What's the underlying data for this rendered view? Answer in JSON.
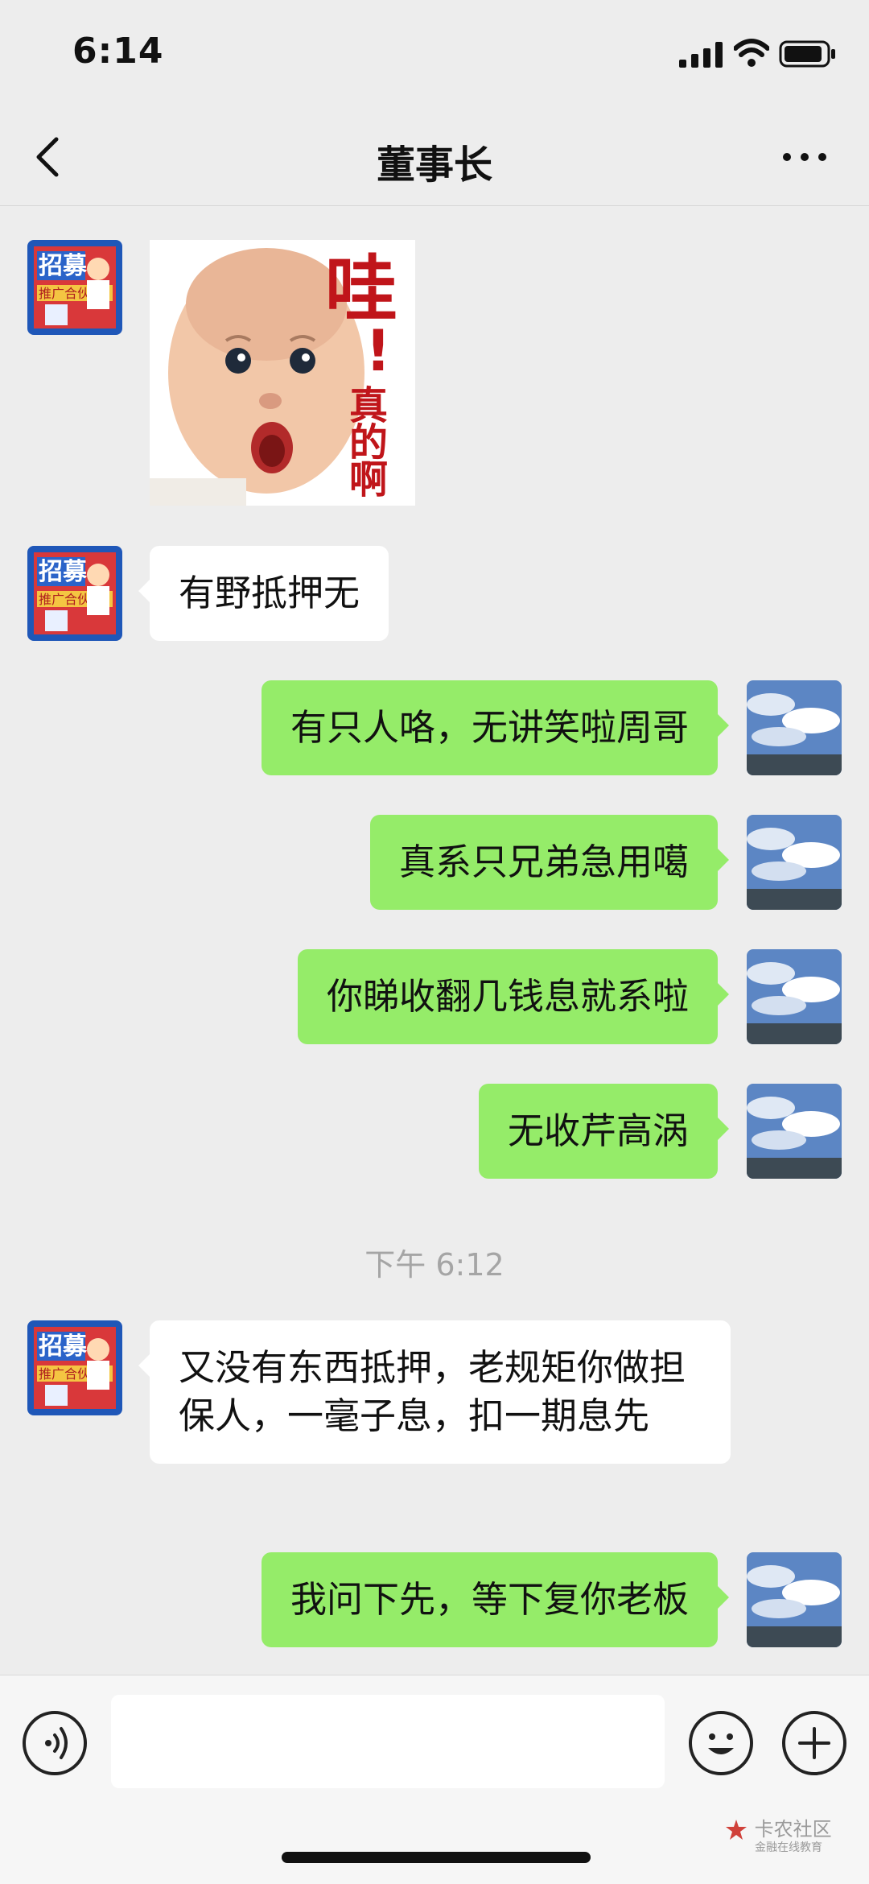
{
  "status_bar": {
    "time": "6:14"
  },
  "header": {
    "title": "董事长"
  },
  "sticker": {
    "big_char": "哇",
    "exclaim": "!",
    "lines": [
      "真",
      "的",
      "啊"
    ]
  },
  "avatar_contact": {
    "line1": "招募",
    "line2": "推广合伙人"
  },
  "messages": [
    {
      "text": "有野抵押无"
    },
    {
      "text": "有只人咯，无讲笑啦周哥"
    },
    {
      "text": "真系只兄弟急用噶"
    },
    {
      "text": "你睇收翻几钱息就系啦"
    },
    {
      "text": "无收芹高涡"
    },
    {
      "text": "又没有东西抵押，老规矩你做担保人，一毫子息，扣一期息先"
    },
    {
      "text": "我问下先，等下复你老板"
    }
  ],
  "timestamp": "下午 6:12",
  "watermark": {
    "name": "卡农社区",
    "sub": "金融在线教育"
  },
  "colors": {
    "background": "#ededed",
    "out_bubble": "#95ec69",
    "in_bubble": "#ffffff"
  }
}
